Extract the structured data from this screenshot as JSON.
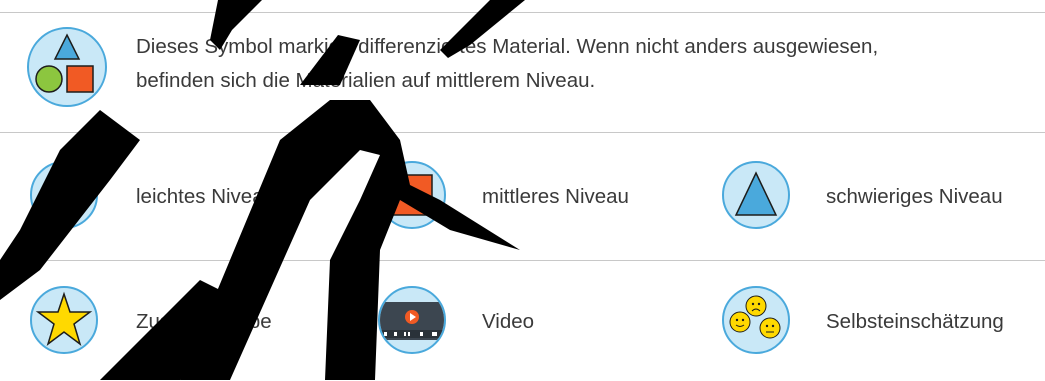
{
  "intro": {
    "line1": "Dieses Symbol markiert differenziertes Material. Wenn nicht anders ausgewiesen,",
    "line2": "befinden sich die Materialien auf mittlerem Niveau."
  },
  "levels": [
    {
      "label": "leichtes Niveau"
    },
    {
      "label": "mittleres Niveau"
    },
    {
      "label": "schwieriges Niveau"
    }
  ],
  "extras": [
    {
      "label": "Zusatzaufgabe"
    },
    {
      "label": "Video"
    },
    {
      "label": "Selbsteinschätzung"
    }
  ],
  "colors": {
    "circle_fill": "#c9e8f7",
    "circle_border": "#4aa9dc",
    "green": "#8cc63f",
    "orange": "#f15a24",
    "blue": "#4aa9dc",
    "yellow": "#ffd900",
    "divider": "#c8c8c8"
  }
}
